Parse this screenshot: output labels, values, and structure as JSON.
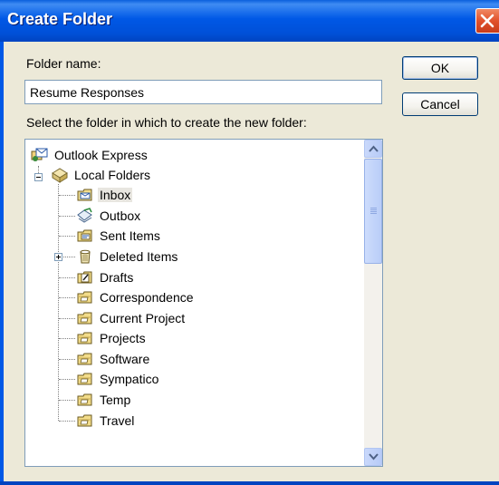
{
  "window": {
    "title": "Create Folder",
    "close_icon": "close-icon"
  },
  "form": {
    "folder_name_label": "Folder name:",
    "folder_name_value": "Resume Responses",
    "select_label": "Select the folder in which to create the new folder:"
  },
  "buttons": {
    "ok_label": "OK",
    "cancel_label": "Cancel"
  },
  "tree": {
    "root": {
      "label": "Outlook Express",
      "icon": "outlook-express-icon"
    },
    "local_folders": {
      "label": "Local Folders",
      "icon": "local-folders-icon",
      "expanded": true
    },
    "items": [
      {
        "label": "Inbox",
        "icon": "inbox-icon",
        "selected": true
      },
      {
        "label": "Outbox",
        "icon": "outbox-icon"
      },
      {
        "label": "Sent Items",
        "icon": "sent-items-icon"
      },
      {
        "label": "Deleted Items",
        "icon": "deleted-items-icon",
        "has_children": true
      },
      {
        "label": "Drafts",
        "icon": "drafts-icon"
      },
      {
        "label": "Correspondence",
        "icon": "folder-icon"
      },
      {
        "label": "Current Project",
        "icon": "folder-icon"
      },
      {
        "label": "Projects",
        "icon": "folder-icon"
      },
      {
        "label": "Software",
        "icon": "folder-icon"
      },
      {
        "label": "Sympatico",
        "icon": "folder-icon"
      },
      {
        "label": "Temp",
        "icon": "folder-icon"
      },
      {
        "label": "Travel",
        "icon": "folder-icon"
      }
    ]
  },
  "colors": {
    "titlebar": "#0058e6",
    "dialog_bg": "#ece9d8",
    "close_button": "#e1512c",
    "field_border": "#7f9db9"
  }
}
